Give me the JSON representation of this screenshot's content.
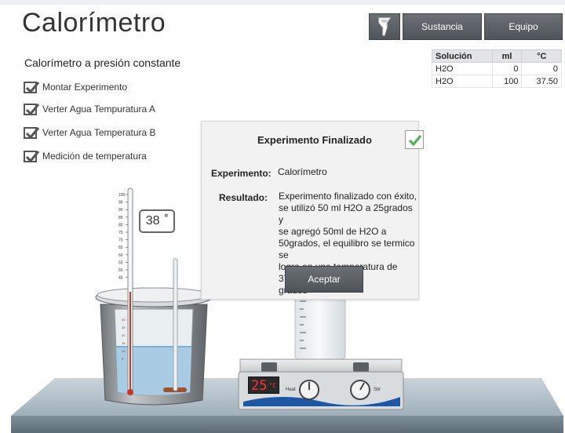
{
  "app": {
    "title": "Calorímetro",
    "subtitle": "Calorímetro a presión constante"
  },
  "toolbar": {
    "icon_button": "flask-icon",
    "sustancia_label": "Sustancia",
    "equipo_label": "Equipo"
  },
  "steps": [
    {
      "label": "Montar Experimento",
      "checked": true
    },
    {
      "label": "Verter  Agua  Tempuratura A",
      "checked": true
    },
    {
      "label": "Verter  Agua  Temperatura B",
      "checked": true
    },
    {
      "label": "Medición de temperatura",
      "checked": true
    }
  ],
  "table": {
    "headers": [
      "Solución",
      "ml",
      "°C"
    ],
    "rows": [
      [
        "H2O",
        "0",
        "0"
      ],
      [
        "H2O",
        "100",
        "37.50"
      ]
    ]
  },
  "thermometer": {
    "reading": "38",
    "degree_symbol": "°",
    "scale_labels": [
      "100",
      "95",
      "90",
      "85",
      "80",
      "75",
      "70",
      "65",
      "60",
      "55",
      "50",
      "45"
    ]
  },
  "hotplate": {
    "display_value": "25",
    "display_unit": "°C",
    "knob_heat_label": "Heat",
    "knob_stir_label": "Stir"
  },
  "dialog": {
    "title": "Experimento Finalizado",
    "experiment_label": "Experimento:",
    "experiment_value": "Calorímetro",
    "result_label": "Resultado:",
    "result_lines": [
      "Experimento finalizado con éxito,",
      "se utilizó 50 ml H2O a 25grados y",
      "se agregó 50ml de H2O a",
      "50grados, el equilibro se termico se",
      "logro en una temperatura de  37.50",
      "grados"
    ],
    "accept_label": "Aceptar"
  },
  "colors": {
    "button_dark": "#5a6065",
    "water": "#a9cbe3",
    "checkmark": "#4caf50",
    "display_red": "#ff3333"
  }
}
